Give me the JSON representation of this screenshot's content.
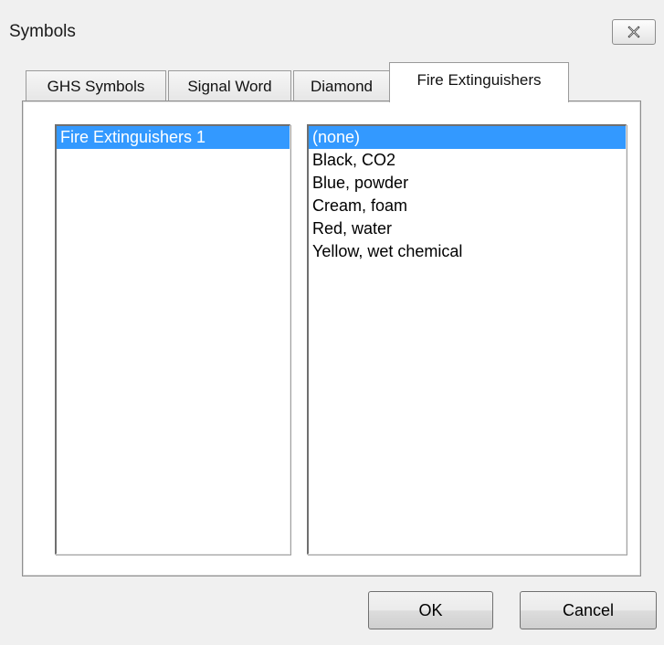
{
  "window": {
    "title": "Symbols",
    "close_icon": "close-x-icon"
  },
  "tabs": [
    {
      "label": "GHS Symbols",
      "active": false
    },
    {
      "label": "Signal Word",
      "active": false
    },
    {
      "label": "Diamond",
      "active": false
    },
    {
      "label": "Fire Extinguishers",
      "active": true
    }
  ],
  "left_list": {
    "items": [
      {
        "label": "Fire Extinguishers 1",
        "selected": true
      }
    ]
  },
  "right_list": {
    "items": [
      {
        "label": "(none)",
        "selected": true
      },
      {
        "label": "Black, CO2",
        "selected": false
      },
      {
        "label": "Blue, powder",
        "selected": false
      },
      {
        "label": "Cream, foam",
        "selected": false
      },
      {
        "label": "Red, water",
        "selected": false
      },
      {
        "label": "Yellow, wet chemical",
        "selected": false
      }
    ]
  },
  "buttons": {
    "ok_label": "OK",
    "cancel_label": "Cancel"
  },
  "colors": {
    "selection": "#3399ff",
    "window_bg": "#f0f0f0"
  }
}
